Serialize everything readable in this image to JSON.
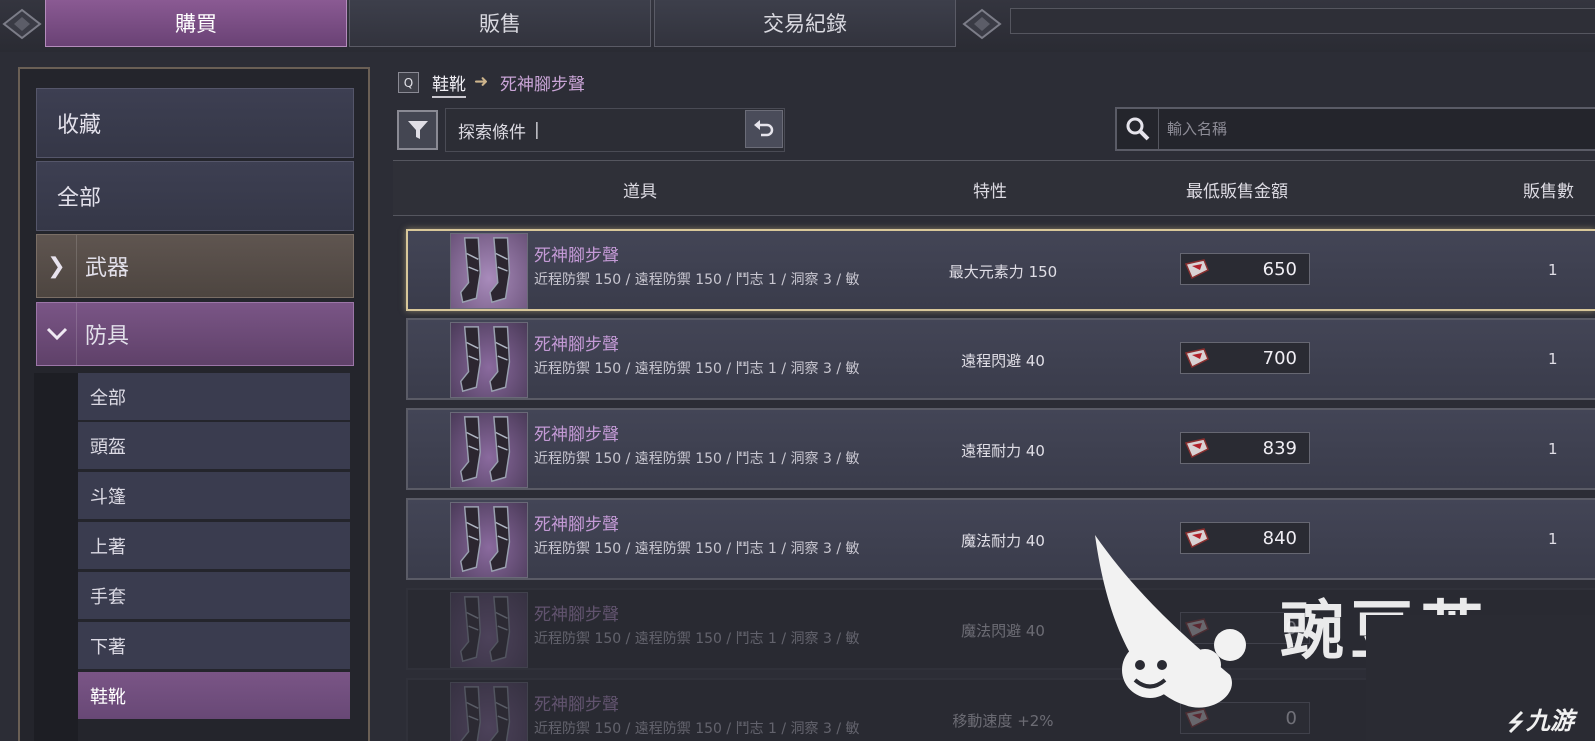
{
  "tabs": [
    {
      "label": "購買",
      "active": true
    },
    {
      "label": "販售",
      "active": false
    },
    {
      "label": "交易紀錄",
      "active": false
    }
  ],
  "sidebar": {
    "favorites": "收藏",
    "all": "全部",
    "weapons": "武器",
    "armor": "防具",
    "armor_subitems": [
      "全部",
      "頭盔",
      "斗篷",
      "上著",
      "手套",
      "下著",
      "鞋靴"
    ],
    "selected_subitem": "鞋靴"
  },
  "breadcrumb": {
    "hotkey": "Q",
    "category": "鞋靴",
    "arrow": "➜",
    "item": "死神腳步聲"
  },
  "filter": {
    "label": "探索條件",
    "caret": "|"
  },
  "search": {
    "placeholder": "輸入名稱"
  },
  "table": {
    "headers": [
      "道具",
      "特性",
      "最低販售金額",
      "販售數"
    ],
    "rows": [
      {
        "name": "死神腳步聲",
        "stats": "近程防禦 150 / 遠程防禦 150 / 鬥志 1 / 洞察 3 / 敏",
        "trait": "最大元素力 150",
        "price": "650",
        "qty": "1",
        "selected": true,
        "dim": false
      },
      {
        "name": "死神腳步聲",
        "stats": "近程防禦 150 / 遠程防禦 150 / 鬥志 1 / 洞察 3 / 敏",
        "trait": "遠程閃避 40",
        "price": "700",
        "qty": "1",
        "selected": false,
        "dim": false
      },
      {
        "name": "死神腳步聲",
        "stats": "近程防禦 150 / 遠程防禦 150 / 鬥志 1 / 洞察 3 / 敏",
        "trait": "遠程耐力 40",
        "price": "839",
        "qty": "1",
        "selected": false,
        "dim": false
      },
      {
        "name": "死神腳步聲",
        "stats": "近程防禦 150 / 遠程防禦 150 / 鬥志 1 / 洞察 3 / 敏",
        "trait": "魔法耐力 40",
        "price": "840",
        "qty": "1",
        "selected": false,
        "dim": false
      },
      {
        "name": "死神腳步聲",
        "stats": "近程防禦 150 / 遠程防禦 150 / 鬥志 1 / 洞察 3 / 敏",
        "trait": "魔法閃避 40",
        "price": "0",
        "qty": "",
        "selected": false,
        "dim": true
      },
      {
        "name": "死神腳步聲",
        "stats": "近程防禦 150 / 遠程防禦 150 / 鬥志 1 / 洞察 3 / 敏",
        "trait": "移動速度 +2%",
        "price": "0",
        "qty": "",
        "selected": false,
        "dim": true
      }
    ]
  },
  "watermark": {
    "text": "豌豆荚",
    "text2": "九游"
  },
  "colors": {
    "accent_purple": "#7a5586",
    "item_name": "#c49ad6",
    "selected_border": "#d8c79a",
    "background": "#2c2d36"
  },
  "icons": [
    "filter-icon",
    "undo-icon",
    "search-icon",
    "chevron-right-icon",
    "chevron-down-icon",
    "gem-icon",
    "boots-icon"
  ]
}
